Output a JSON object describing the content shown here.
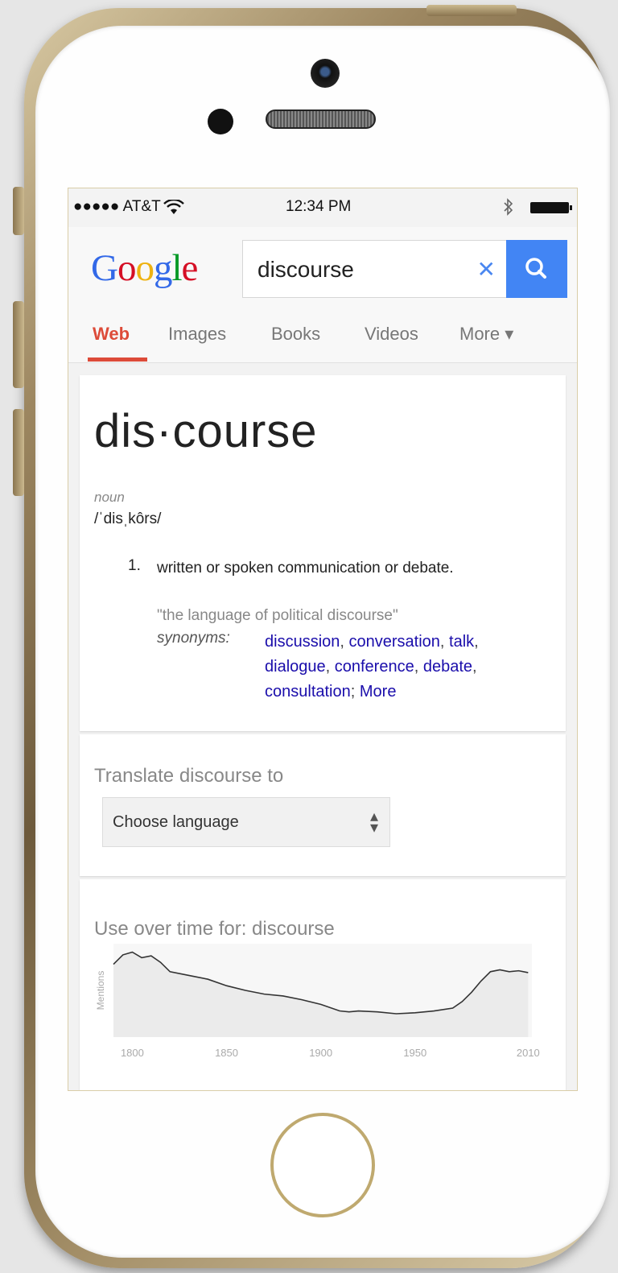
{
  "status_bar": {
    "carrier": "●●●●● AT&T",
    "time": "12:34 PM"
  },
  "search": {
    "logo_letters": [
      "G",
      "o",
      "o",
      "g",
      "l",
      "e"
    ],
    "query": "discourse"
  },
  "tabs": [
    {
      "label": "Web",
      "active": true
    },
    {
      "label": "Images",
      "active": false
    },
    {
      "label": "Books",
      "active": false
    },
    {
      "label": "Videos",
      "active": false
    },
    {
      "label": "More ▾",
      "active": false
    }
  ],
  "definition": {
    "headword": "dis·course",
    "part_of_speech": "noun",
    "pronunciation": "/ˈdisˌkôrs/",
    "sense_number": "1.",
    "sense_text": "written or spoken communication or debate.",
    "example": "\"the language of political discourse\"",
    "synonyms_label": "synonyms:",
    "synonyms": [
      "discussion",
      "conversation",
      "talk",
      "dialogue",
      "conference",
      "debate",
      "consultation"
    ],
    "more_link": "More"
  },
  "translate": {
    "label": "Translate discourse to",
    "select_value": "Choose language"
  },
  "usage": {
    "title": "Use over time for: discourse"
  },
  "chart_data": {
    "type": "area",
    "title": "Use over time for: discourse",
    "ylabel": "Mentions",
    "xlabel": "",
    "x_ticks": [
      "1800",
      "1850",
      "1900",
      "1950",
      "2010"
    ],
    "x": [
      1790,
      1795,
      1800,
      1805,
      1810,
      1815,
      1820,
      1830,
      1840,
      1850,
      1860,
      1870,
      1880,
      1890,
      1900,
      1910,
      1915,
      1920,
      1930,
      1940,
      1950,
      1960,
      1970,
      1975,
      1980,
      1985,
      1990,
      1995,
      2000,
      2005,
      2010
    ],
    "values": [
      78,
      88,
      91,
      85,
      87,
      80,
      70,
      66,
      62,
      55,
      50,
      46,
      44,
      40,
      35,
      28,
      27,
      28,
      27,
      25,
      26,
      28,
      31,
      38,
      48,
      60,
      70,
      72,
      70,
      71,
      69
    ],
    "ylim": [
      0,
      100
    ],
    "xlim": [
      1790,
      2012
    ],
    "line_color": "#333333",
    "fill_color": "#ebebeb"
  }
}
